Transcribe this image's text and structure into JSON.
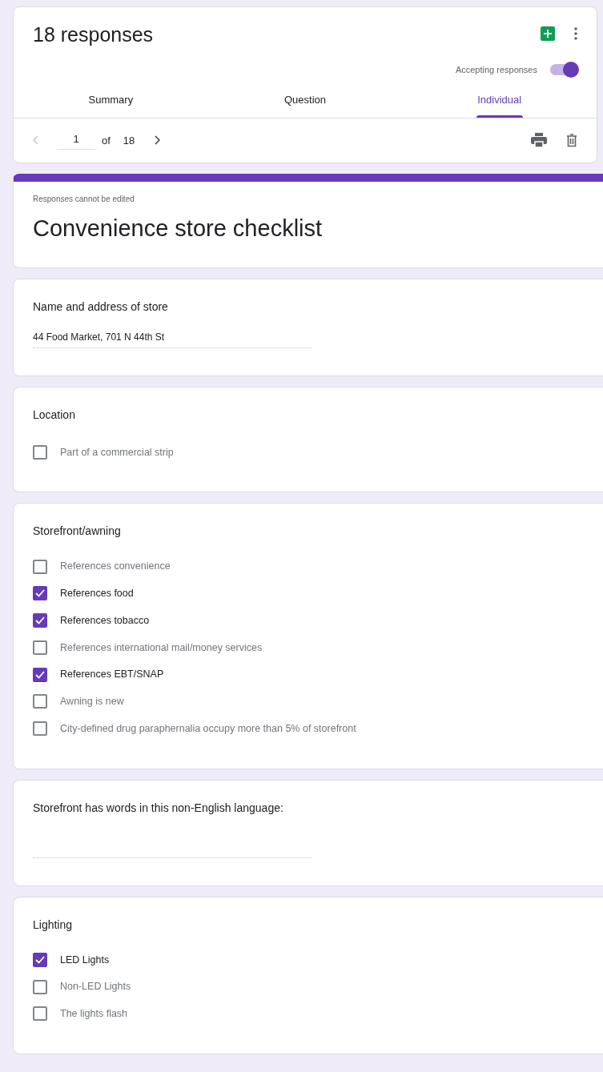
{
  "header": {
    "title": "18 responses",
    "accepting_label": "Accepting responses",
    "accepting": true,
    "tabs": [
      {
        "label": "Summary",
        "selected": false
      },
      {
        "label": "Question",
        "selected": false
      },
      {
        "label": "Individual",
        "selected": true
      }
    ],
    "pager": {
      "current": "1",
      "of_label": "of",
      "total": "18"
    }
  },
  "form": {
    "note": "Responses cannot be edited",
    "title": "Convenience store checklist"
  },
  "questions": [
    {
      "kind": "text",
      "title": "Name and address of store",
      "value": "44 Food Market, 701 N 44th St"
    },
    {
      "kind": "checkbox",
      "title": "Location",
      "options": [
        {
          "label": "Part of a commercial strip",
          "checked": false
        }
      ]
    },
    {
      "kind": "checkbox",
      "title": "Storefront/awning",
      "options": [
        {
          "label": "References convenience",
          "checked": false
        },
        {
          "label": "References food",
          "checked": true
        },
        {
          "label": "References tobacco",
          "checked": true
        },
        {
          "label": "References international mail/money services",
          "checked": false
        },
        {
          "label": "References EBT/SNAP",
          "checked": true
        },
        {
          "label": "Awning is new",
          "checked": false
        },
        {
          "label": "City-defined drug paraphernalia occupy more than 5% of storefront",
          "checked": false
        }
      ]
    },
    {
      "kind": "text",
      "title": "Storefront has words in this non-English language:"
    },
    {
      "kind": "checkbox",
      "title": "Lighting",
      "options": [
        {
          "label": "LED Lights",
          "checked": true
        },
        {
          "label": "Non-LED Lights",
          "checked": false
        },
        {
          "label": "The lights flash",
          "checked": false
        }
      ]
    }
  ]
}
